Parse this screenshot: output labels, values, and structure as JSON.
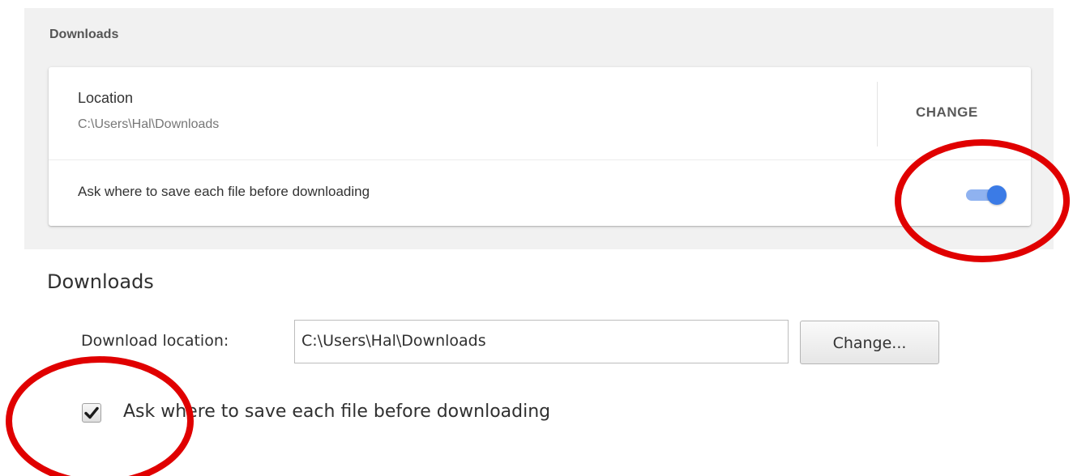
{
  "new_settings": {
    "section_title": "Downloads",
    "location": {
      "label": "Location",
      "path": "C:\\Users\\Hal\\Downloads",
      "change_label": "CHANGE"
    },
    "ask_toggle": {
      "label": "Ask where to save each file before downloading",
      "checked": true
    }
  },
  "old_settings": {
    "section_title": "Downloads",
    "download_location_label": "Download location:",
    "download_location_value": "C:\\Users\\Hal\\Downloads",
    "change_button_label": "Change...",
    "ask_checkbox": {
      "label": "Ask where to save each file before downloading",
      "checked": true
    }
  },
  "colors": {
    "panel_background": "#f1f1f1",
    "toggle_track": "#8fb2f0",
    "toggle_knob": "#3b7be6",
    "annotation_red": "#e00000"
  },
  "icons": {
    "toggle": "toggle-switch-icon",
    "checkbox_check": "checkmark-icon"
  }
}
